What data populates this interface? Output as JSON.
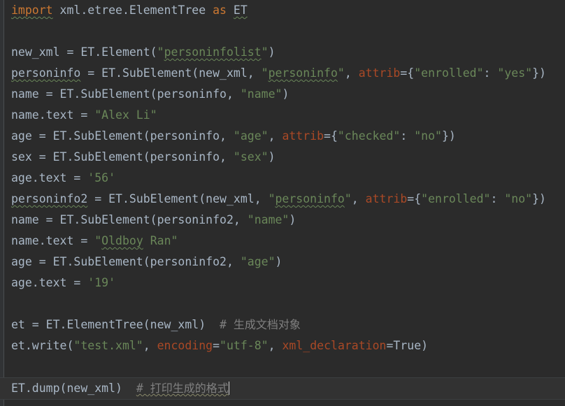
{
  "editor": {
    "language": "python",
    "background_color": "#2b2b2b",
    "default_text_color": "#a9b7c6",
    "keyword_color": "#cc7832",
    "string_color": "#6a8759",
    "kwarg_color": "#aa4926",
    "comment_color": "#808080",
    "caret_line_background": "#323232",
    "gutter_color": "#313335"
  },
  "lines": [
    {
      "n": 1,
      "tokens": [
        {
          "t": "import",
          "c": "kw",
          "u": "wavy"
        },
        {
          "t": " xml.etree.ElementTree ",
          "c": "plain"
        },
        {
          "t": "as",
          "c": "kw"
        },
        {
          "t": " ",
          "c": "plain"
        },
        {
          "t": "ET",
          "c": "plain",
          "u": "wavy"
        }
      ]
    },
    {
      "n": 2,
      "tokens": []
    },
    {
      "n": 3,
      "tokens": [
        {
          "t": "new_xml = ET.Element(",
          "c": "plain"
        },
        {
          "t": "\"",
          "c": "str"
        },
        {
          "t": "personinfolist",
          "c": "str",
          "u": "wavy"
        },
        {
          "t": "\"",
          "c": "str"
        },
        {
          "t": ")",
          "c": "plain"
        }
      ]
    },
    {
      "n": 4,
      "tokens": [
        {
          "t": "personinfo",
          "c": "plain",
          "u": "wavy"
        },
        {
          "t": " = ET.SubElement(new_xml, ",
          "c": "plain"
        },
        {
          "t": "\"",
          "c": "str"
        },
        {
          "t": "personinfo",
          "c": "str",
          "u": "wavy"
        },
        {
          "t": "\"",
          "c": "str"
        },
        {
          "t": ", ",
          "c": "plain"
        },
        {
          "t": "attrib",
          "c": "kwarg"
        },
        {
          "t": "={",
          "c": "plain"
        },
        {
          "t": "\"enrolled\"",
          "c": "str"
        },
        {
          "t": ": ",
          "c": "plain"
        },
        {
          "t": "\"yes\"",
          "c": "str"
        },
        {
          "t": "})",
          "c": "plain"
        }
      ]
    },
    {
      "n": 5,
      "tokens": [
        {
          "t": "name = ET.SubElement(personinfo, ",
          "c": "plain"
        },
        {
          "t": "\"name\"",
          "c": "str"
        },
        {
          "t": ")",
          "c": "plain"
        }
      ]
    },
    {
      "n": 6,
      "tokens": [
        {
          "t": "name.text = ",
          "c": "plain"
        },
        {
          "t": "\"Alex Li\"",
          "c": "str"
        }
      ]
    },
    {
      "n": 7,
      "tokens": [
        {
          "t": "age = ET.SubElement(personinfo, ",
          "c": "plain"
        },
        {
          "t": "\"age\"",
          "c": "str"
        },
        {
          "t": ", ",
          "c": "plain"
        },
        {
          "t": "attrib",
          "c": "kwarg"
        },
        {
          "t": "={",
          "c": "plain"
        },
        {
          "t": "\"checked\"",
          "c": "str"
        },
        {
          "t": ": ",
          "c": "plain"
        },
        {
          "t": "\"no\"",
          "c": "str"
        },
        {
          "t": "})",
          "c": "plain"
        }
      ]
    },
    {
      "n": 8,
      "tokens": [
        {
          "t": "sex = ET.SubElement(personinfo, ",
          "c": "plain"
        },
        {
          "t": "\"sex\"",
          "c": "str"
        },
        {
          "t": ")",
          "c": "plain"
        }
      ]
    },
    {
      "n": 9,
      "tokens": [
        {
          "t": "age.text = ",
          "c": "plain"
        },
        {
          "t": "'56'",
          "c": "num"
        }
      ]
    },
    {
      "n": 10,
      "tokens": [
        {
          "t": "personinfo2",
          "c": "plain",
          "u": "wavy"
        },
        {
          "t": " = ET.SubElement(new_xml, ",
          "c": "plain"
        },
        {
          "t": "\"",
          "c": "str"
        },
        {
          "t": "personinfo",
          "c": "str",
          "u": "wavy"
        },
        {
          "t": "\"",
          "c": "str"
        },
        {
          "t": ", ",
          "c": "plain"
        },
        {
          "t": "attrib",
          "c": "kwarg"
        },
        {
          "t": "={",
          "c": "plain"
        },
        {
          "t": "\"enrolled\"",
          "c": "str"
        },
        {
          "t": ": ",
          "c": "plain"
        },
        {
          "t": "\"no\"",
          "c": "str"
        },
        {
          "t": "})",
          "c": "plain"
        }
      ]
    },
    {
      "n": 11,
      "tokens": [
        {
          "t": "name = ET.SubElement(personinfo2, ",
          "c": "plain"
        },
        {
          "t": "\"name\"",
          "c": "str"
        },
        {
          "t": ")",
          "c": "plain"
        }
      ]
    },
    {
      "n": 12,
      "tokens": [
        {
          "t": "name.text = ",
          "c": "plain"
        },
        {
          "t": "\"",
          "c": "str"
        },
        {
          "t": "Oldboy",
          "c": "str",
          "u": "wavy"
        },
        {
          "t": " Ran\"",
          "c": "str"
        }
      ]
    },
    {
      "n": 13,
      "tokens": [
        {
          "t": "age = ET.SubElement(personinfo2, ",
          "c": "plain"
        },
        {
          "t": "\"age\"",
          "c": "str"
        },
        {
          "t": ")",
          "c": "plain"
        }
      ]
    },
    {
      "n": 14,
      "tokens": [
        {
          "t": "age.text = ",
          "c": "plain"
        },
        {
          "t": "'19'",
          "c": "num"
        }
      ]
    },
    {
      "n": 15,
      "tokens": []
    },
    {
      "n": 16,
      "tokens": [
        {
          "t": "et = ET.ElementTree(new_xml)  ",
          "c": "plain"
        },
        {
          "t": "# ",
          "c": "cmt"
        },
        {
          "t": "生成文档对象",
          "c": "cmt",
          "cn": true
        }
      ]
    },
    {
      "n": 17,
      "tokens": [
        {
          "t": "et.write(",
          "c": "plain"
        },
        {
          "t": "\"test.xml\"",
          "c": "str"
        },
        {
          "t": ", ",
          "c": "plain"
        },
        {
          "t": "encoding",
          "c": "kwarg"
        },
        {
          "t": "=",
          "c": "plain"
        },
        {
          "t": "\"utf-8\"",
          "c": "str"
        },
        {
          "t": ", ",
          "c": "plain"
        },
        {
          "t": "xml_declaration",
          "c": "kwarg"
        },
        {
          "t": "=",
          "c": "plain"
        },
        {
          "t": "True",
          "c": "plain"
        },
        {
          "t": ")",
          "c": "plain"
        }
      ]
    },
    {
      "n": 18,
      "tokens": []
    },
    {
      "n": 19,
      "caret_line": true,
      "caret_at_end": true,
      "tokens": [
        {
          "t": "ET.dump(new_xml)  ",
          "c": "plain"
        },
        {
          "t": "# ",
          "c": "cmt",
          "u": "wavy-c"
        },
        {
          "t": "打印生成的格式",
          "c": "cmt",
          "cn": true,
          "u": "wavy-c"
        }
      ]
    }
  ]
}
